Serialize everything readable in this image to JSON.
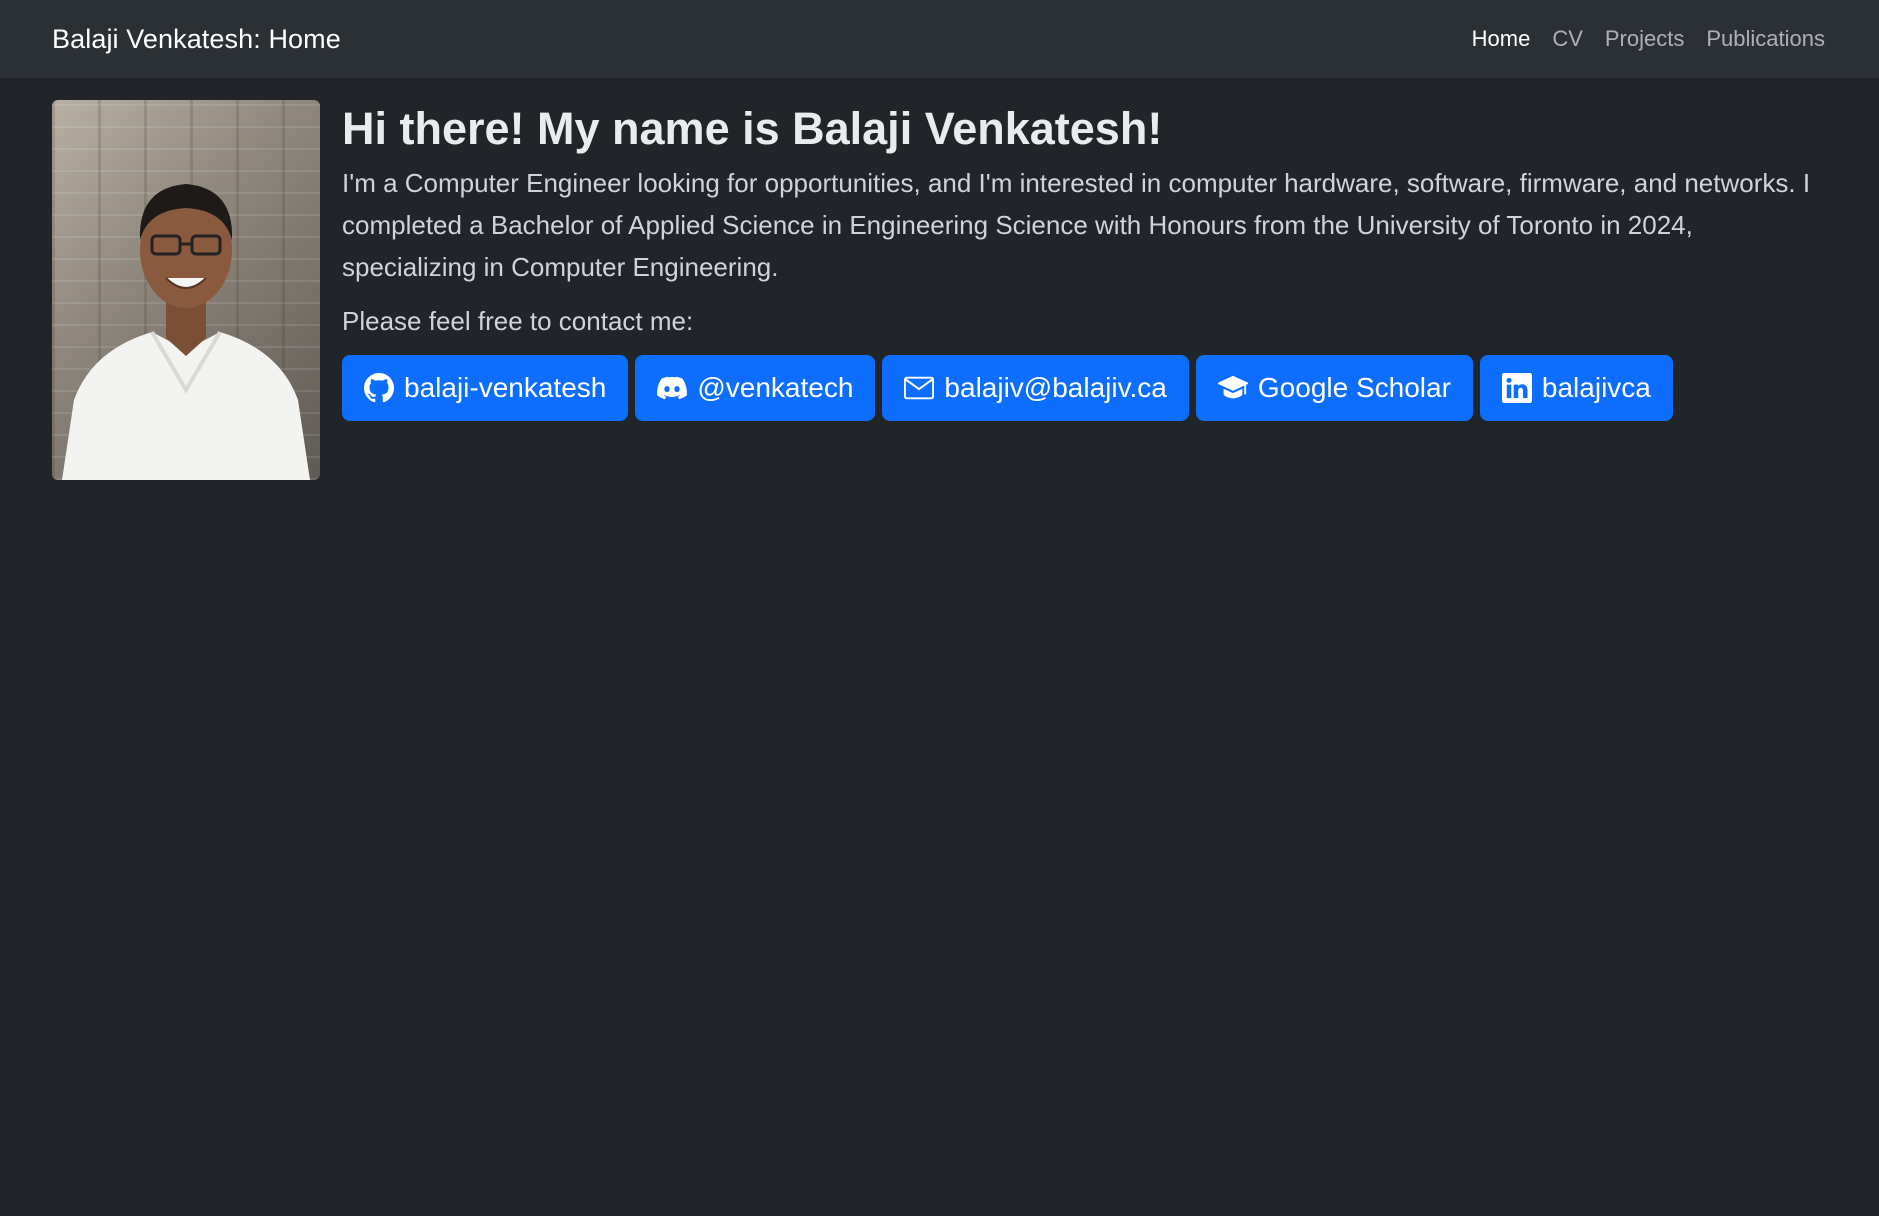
{
  "navbar": {
    "brand": "Balaji Venkatesh: Home",
    "links": [
      "Home",
      "CV",
      "Projects",
      "Publications"
    ],
    "active": "Home"
  },
  "profile": {
    "heading": "Hi there! My name is Balaji Venkatesh!",
    "bio": "I'm a Computer Engineer looking for opportunities, and I'm interested in computer hardware, software, firmware, and networks. I completed a Bachelor of Applied Science in Engineering Science with Honours from the University of Toronto in 2024, specializing in Computer Engineering.",
    "contact_lead": "Please feel free to contact me:"
  },
  "contact_buttons": [
    {
      "label": "balaji-venkatesh",
      "icon": "github-icon"
    },
    {
      "label": "@venkatech",
      "icon": "discord-icon"
    },
    {
      "label": "balajiv@balajiv.ca",
      "icon": "envelope-icon"
    },
    {
      "label": "Google Scholar",
      "icon": "mortarboard-icon"
    },
    {
      "label": "balajivca",
      "icon": "linkedin-icon"
    }
  ],
  "colors": {
    "background": "#212529",
    "navbar": "#2b3035",
    "button": "#0d6efd"
  }
}
